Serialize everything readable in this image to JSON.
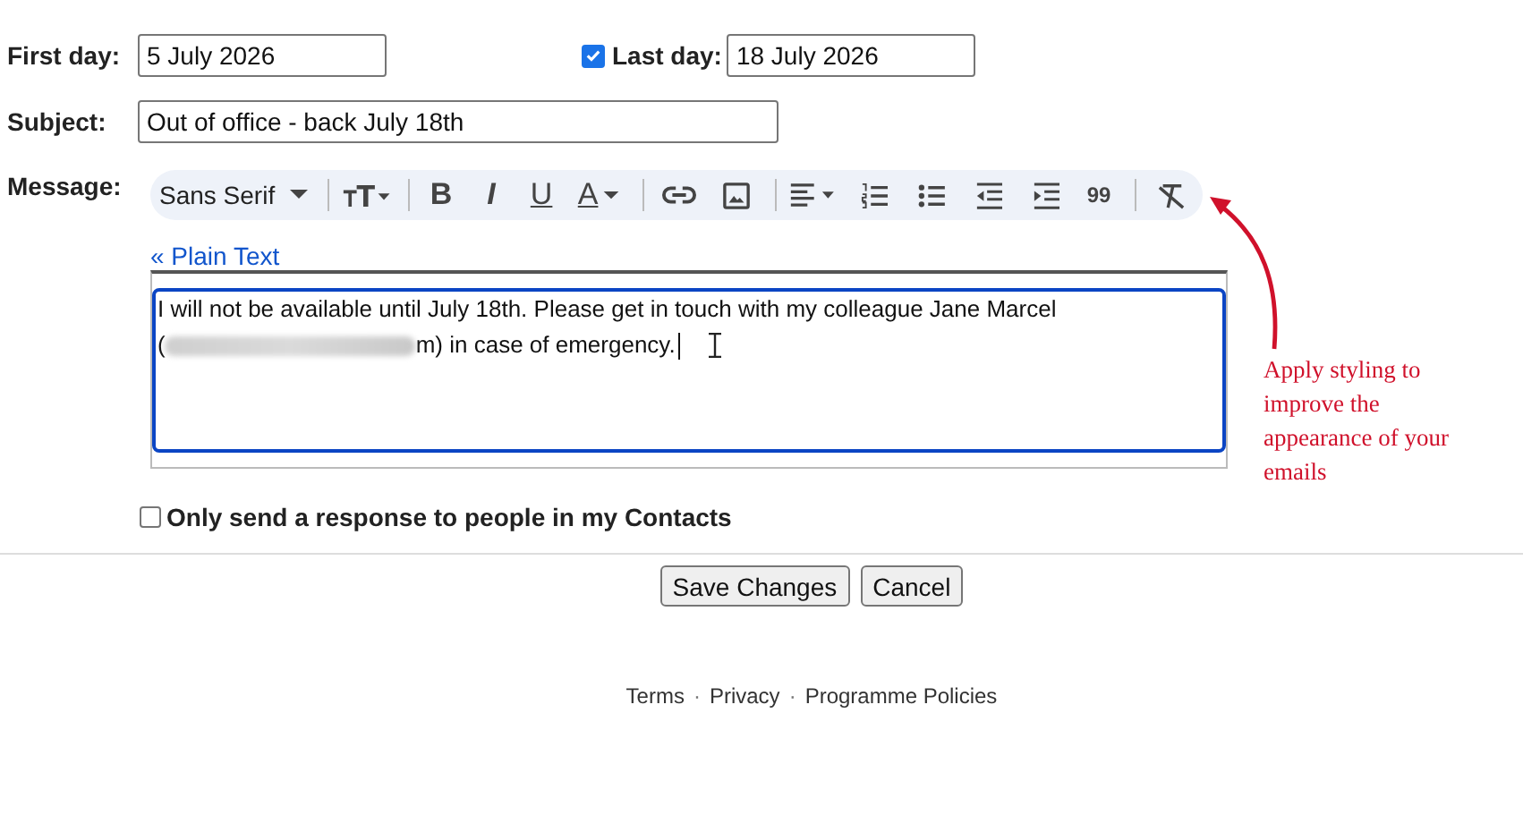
{
  "first_day": {
    "label": "First day:",
    "value": "5 July 2026"
  },
  "last_day": {
    "label": "Last day:",
    "value": "18 July 2026",
    "checked": true
  },
  "subject": {
    "label": "Subject:",
    "value": "Out of office - back July 18th"
  },
  "message": {
    "label": "Message:",
    "toolbar": [
      {
        "kind": "font",
        "label": "Sans Serif"
      },
      {
        "kind": "divider"
      },
      {
        "kind": "text-size"
      },
      {
        "kind": "divider"
      },
      {
        "kind": "bold",
        "label": "B"
      },
      {
        "kind": "italic",
        "label": "I"
      },
      {
        "kind": "underline",
        "label": "U"
      },
      {
        "kind": "color",
        "label": "A"
      },
      {
        "kind": "divider"
      },
      {
        "kind": "link"
      },
      {
        "kind": "image"
      },
      {
        "kind": "divider"
      },
      {
        "kind": "align"
      },
      {
        "kind": "numbered-list"
      },
      {
        "kind": "bulleted-list"
      },
      {
        "kind": "indent-less"
      },
      {
        "kind": "indent-more"
      },
      {
        "kind": "quote",
        "label": "99"
      },
      {
        "kind": "divider"
      },
      {
        "kind": "clear-format"
      }
    ],
    "plain_text_link": "« Plain Text",
    "line_1": "I will not be available until July 18th. Please get in touch with my colleague Jane Marcel",
    "line_2_start": "(",
    "line_2_end": "m) in case of emergency."
  },
  "contacts_only": {
    "label": "Only send a response to people in my Contacts",
    "checked": false
  },
  "buttons": [
    "Save Changes",
    "Cancel"
  ],
  "footer": [
    {
      "kind": "link",
      "label": "Terms"
    },
    {
      "kind": "separator",
      "label": "·"
    },
    {
      "kind": "link",
      "label": "Privacy"
    },
    {
      "kind": "separator",
      "label": "·"
    },
    {
      "kind": "link",
      "label": "Programme Policies"
    }
  ],
  "annotation": "Apply styling to improve the appearance of your emails"
}
